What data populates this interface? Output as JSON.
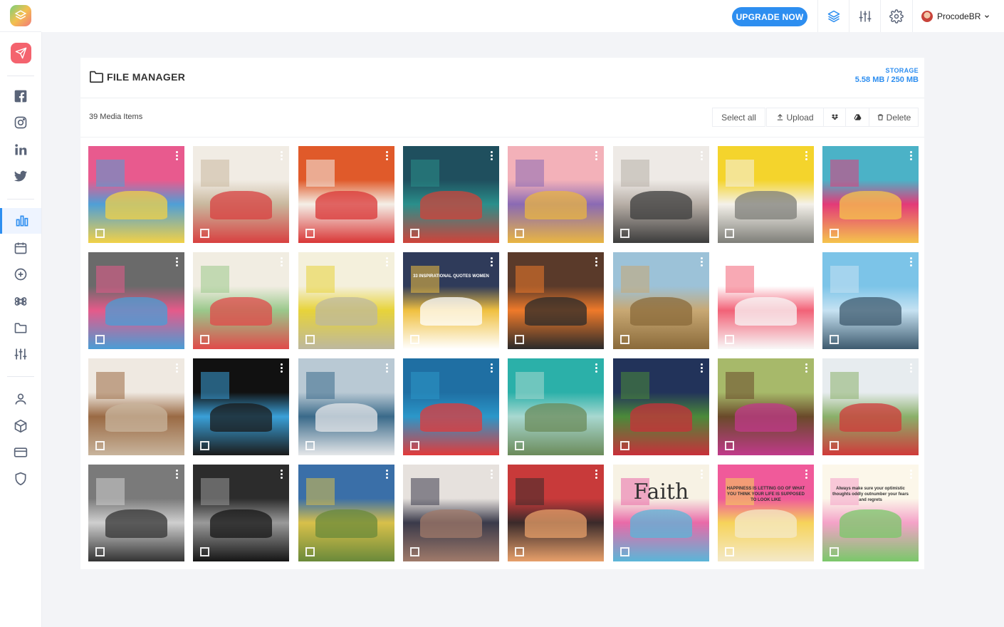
{
  "app": {
    "colors": {
      "accent": "#2d8ef0",
      "send": "#f4636e",
      "background": "#f3f4f7"
    }
  },
  "sidebar": {
    "logo_icon": "layers-logo-icon",
    "compose_icon": "paper-plane-icon",
    "social": [
      {
        "name": "facebook",
        "icon": "facebook-icon"
      },
      {
        "name": "instagram",
        "icon": "instagram-icon"
      },
      {
        "name": "linkedin",
        "icon": "linkedin-icon"
      },
      {
        "name": "twitter",
        "icon": "twitter-icon"
      }
    ],
    "tools": [
      {
        "name": "analytics",
        "icon": "bar-chart-icon",
        "active": true
      },
      {
        "name": "calendar",
        "icon": "calendar-icon"
      },
      {
        "name": "add",
        "icon": "plus-circle-icon"
      },
      {
        "name": "command",
        "icon": "command-icon"
      },
      {
        "name": "files",
        "icon": "folder-icon"
      },
      {
        "name": "adjust",
        "icon": "sliders-icon"
      }
    ],
    "account": [
      {
        "name": "profile",
        "icon": "user-icon"
      },
      {
        "name": "packages",
        "icon": "package-icon"
      },
      {
        "name": "billing",
        "icon": "credit-card-icon"
      },
      {
        "name": "security",
        "icon": "shield-icon"
      }
    ]
  },
  "topbar": {
    "upgrade_label": "UPGRADE NOW",
    "icons": [
      "layers-icon",
      "sliders-icon",
      "gear-icon"
    ],
    "user_name": "ProcodeBR"
  },
  "file_manager": {
    "title": "FILE MANAGER",
    "storage_label": "STORAGE",
    "storage_value": "5.58 MB / 250 MB",
    "media_count": "39 Media Items",
    "toolbar": {
      "select_all": "Select all",
      "upload": "Upload",
      "dropbox_icon": "dropbox-icon",
      "google_drive_icon": "google-drive-icon",
      "delete": "Delete"
    },
    "items": [
      {
        "colors": [
          "#e85a8e",
          "#4f9fd6",
          "#f2d147"
        ],
        "caption": ""
      },
      {
        "colors": [
          "#f1ece4",
          "#c9b89e",
          "#d84040"
        ],
        "caption": ""
      },
      {
        "colors": [
          "#e05a2a",
          "#f4efe7",
          "#d93636"
        ],
        "caption": ""
      },
      {
        "colors": [
          "#1f4f5e",
          "#2a8f8b",
          "#d0433a"
        ],
        "caption": ""
      },
      {
        "colors": [
          "#f3b1b9",
          "#8a6ab4",
          "#e9b542"
        ],
        "caption": ""
      },
      {
        "colors": [
          "#eeeae6",
          "#b7aea6",
          "#3c3c3c"
        ],
        "caption": ""
      },
      {
        "colors": [
          "#f4d42c",
          "#f4f1ea",
          "#7e7e78"
        ],
        "caption": ""
      },
      {
        "colors": [
          "#4bb2c7",
          "#e33a78",
          "#f5c44c"
        ],
        "caption": ""
      },
      {
        "colors": [
          "#6a6a6a",
          "#e55a8a",
          "#4a9dd5"
        ],
        "caption": ""
      },
      {
        "colors": [
          "#f1ede2",
          "#9ac88b",
          "#e04a4a"
        ],
        "caption": ""
      },
      {
        "colors": [
          "#f4f0dc",
          "#e7d33a",
          "#bdb89e"
        ],
        "caption": ""
      },
      {
        "colors": [
          "#2f3b5a",
          "#f0c040",
          "#ffffff"
        ],
        "caption": "33 INSPIRATIONAL QUOTES WOMEN"
      },
      {
        "colors": [
          "#5a3a2a",
          "#ef7a2a",
          "#2a2a2a"
        ],
        "caption": ""
      },
      {
        "colors": [
          "#9cc2d8",
          "#c8a873",
          "#8a6a3a"
        ],
        "caption": ""
      },
      {
        "colors": [
          "#ffffff",
          "#f26277",
          "#f8f8f8"
        ],
        "caption": ""
      },
      {
        "colors": [
          "#7cc4e8",
          "#c6e2f2",
          "#3d5a6e"
        ],
        "caption": ""
      },
      {
        "colors": [
          "#efe9e1",
          "#9a6a44",
          "#c8b49c"
        ],
        "caption": ""
      },
      {
        "colors": [
          "#111111",
          "#3aa0d8",
          "#1a1a1a"
        ],
        "caption": ""
      },
      {
        "colors": [
          "#b9c9d4",
          "#3a6a8a",
          "#e5e7e9"
        ],
        "caption": ""
      },
      {
        "colors": [
          "#1f6fa3",
          "#2b97c9",
          "#e23a3a"
        ],
        "caption": ""
      },
      {
        "colors": [
          "#2bb0a9",
          "#a8d8d0",
          "#6b8b5a"
        ],
        "caption": ""
      },
      {
        "colors": [
          "#22335a",
          "#4b8a3a",
          "#c8303a"
        ],
        "caption": ""
      },
      {
        "colors": [
          "#a7b96a",
          "#6a4a2a",
          "#c03a8a"
        ],
        "caption": ""
      },
      {
        "colors": [
          "#e7ecef",
          "#8ab06a",
          "#d03a3a"
        ],
        "caption": ""
      },
      {
        "colors": [
          "#7a7a7a",
          "#cfcfcf",
          "#333333"
        ],
        "caption": ""
      },
      {
        "colors": [
          "#2c2c2c",
          "#9a9a9a",
          "#151515"
        ],
        "caption": ""
      },
      {
        "colors": [
          "#3a6fa8",
          "#d8c04a",
          "#6a8a3a"
        ],
        "caption": ""
      },
      {
        "colors": [
          "#e6e1dd",
          "#3a3a4a",
          "#a07a6a"
        ],
        "caption": ""
      },
      {
        "colors": [
          "#c83a3a",
          "#3a2a2a",
          "#e8a06a"
        ],
        "caption": ""
      },
      {
        "colors": [
          "#f7f2e4",
          "#e96aa8",
          "#5ab6d8"
        ],
        "caption": "Faith"
      },
      {
        "colors": [
          "#f05a9a",
          "#f6d35a",
          "#f4e9c8"
        ],
        "caption": "HAPPINESS IS LETTING GO OF WHAT YOU THINK YOUR LIFE IS SUPPOSED TO LOOK LIKE"
      },
      {
        "colors": [
          "#fcf7ea",
          "#f4a2c8",
          "#7ac86a"
        ],
        "caption": "Always make sure your optimistic thoughts oddly outnumber your fears and regrets"
      }
    ]
  }
}
